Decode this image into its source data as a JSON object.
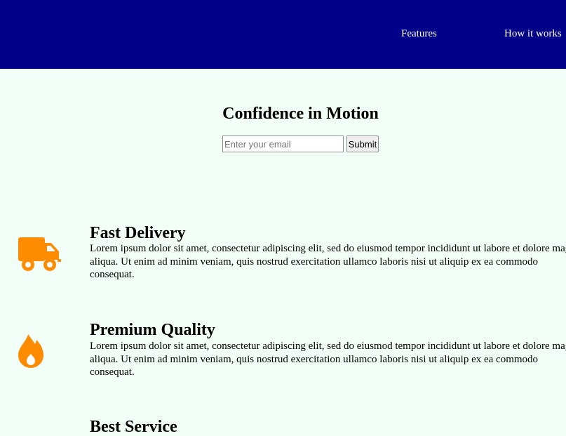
{
  "colors": {
    "header_bg": "#000088",
    "page_bg": "#f2fff9",
    "icon_color": "#ff8c00"
  },
  "nav": {
    "items": [
      {
        "label": "Features"
      },
      {
        "label": "How it works"
      }
    ]
  },
  "hero": {
    "title": "Confidence in Motion",
    "email_placeholder": "Enter your email",
    "submit_label": "Submit"
  },
  "features": [
    {
      "icon": "truck-icon",
      "title": "Fast Delivery",
      "text": "Lorem ipsum dolor sit amet, consectetur adipiscing elit, sed do eiusmod tempor incididunt ut labore et dolore magna aliqua. Ut enim ad minim veniam, quis nostrud exercitation ullamco laboris nisi ut aliquip ex ea commodo consequat."
    },
    {
      "icon": "fire-icon",
      "title": "Premium Quality",
      "text": "Lorem ipsum dolor sit amet, consectetur adipiscing elit, sed do eiusmod tempor incididunt ut labore et dolore magna aliqua. Ut enim ad minim veniam, quis nostrud exercitation ullamco laboris nisi ut aliquip ex ea commodo consequat."
    },
    {
      "title": "Best Service"
    }
  ]
}
